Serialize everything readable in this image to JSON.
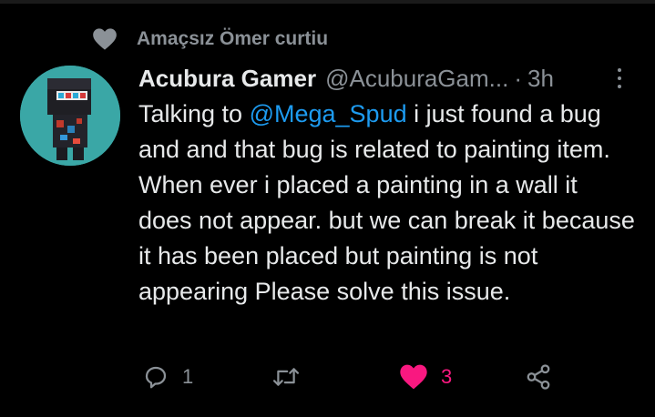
{
  "social_context": {
    "label": "Amaçsız Ömer curtiu"
  },
  "tweet": {
    "author_name": "Acubura Gamer",
    "author_handle": "@AcuburaGam...",
    "separator": "·",
    "time": "3h",
    "text_before_mention": "Talking to ",
    "mention": "@Mega_Spud",
    "text_after_mention": " i just found a bug and and that bug is related to painting item. When ever i placed a painting in a wall it does not appear. but we can break it because it has been placed but painting is not appearing Please solve this issue."
  },
  "actions": {
    "reply_count": "1",
    "retweet_count": "",
    "like_count": "3",
    "liked": true
  },
  "colors": {
    "background": "#000000",
    "text_primary": "#e7e9ea",
    "text_secondary": "#8b9197",
    "mention": "#1d9bf0",
    "like": "#f91880",
    "avatar_bg": "#3aa7a6"
  },
  "icons": {
    "social_context": "heart-icon",
    "more": "more-vertical-icon",
    "reply": "reply-icon",
    "retweet": "retweet-icon",
    "like": "heart-filled-icon",
    "share": "share-icon"
  }
}
